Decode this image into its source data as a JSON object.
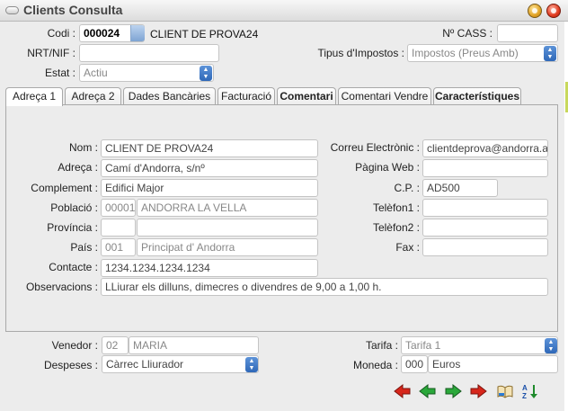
{
  "window": {
    "title": "Clients Consulta"
  },
  "header": {
    "codi_label": "Codi :",
    "codi_value": "000024",
    "client_name": "CLIENT DE PROVA24",
    "cass_label": "Nº CASS :",
    "cass_value": "",
    "nrt_label": "NRT/NIF :",
    "nrt_value": "",
    "tipus_label": "Tipus d'Impostos :",
    "tipus_value": "Impostos (Preus Amb)",
    "estat_label": "Estat :",
    "estat_value": "Actiu"
  },
  "tabs": [
    {
      "label": "Adreça 1"
    },
    {
      "label": "Adreça 2"
    },
    {
      "label": "Dades Bancàries"
    },
    {
      "label": "Facturació"
    },
    {
      "label": "Comentari"
    },
    {
      "label": "Comentari Vendre"
    },
    {
      "label": "Característiques"
    }
  ],
  "address": {
    "nom_label": "Nom :",
    "nom_value": "CLIENT DE PROVA24",
    "adreca_label": "Adreça :",
    "adreca_value": "Camí d'Andorra, s/nº",
    "complement_label": "Complement :",
    "complement_value": "Edifici Major",
    "poblacio_label": "Població :",
    "poblacio_code": "00001",
    "poblacio_name": "ANDORRA LA VELLA",
    "provincia_label": "Província :",
    "provincia_code": "",
    "provincia_name": "",
    "pais_label": "País :",
    "pais_code": "001",
    "pais_name": "Principat d' Andorra",
    "contacte_label": "Contacte :",
    "contacte_value": "1234.1234.1234.1234",
    "observacions_label": "Observacions :",
    "observacions_value": "LLiurar els dilluns, dimecres o divendres de 9,00 a 1,00 h.",
    "correu_label": "Correu Electrònic :",
    "correu_value": "clientdeprova@andorra.ad",
    "pagina_label": "Pàgina Web :",
    "pagina_value": "",
    "cp_label": "C.P. :",
    "cp_value": "AD500",
    "telefon1_label": "Telèfon1 :",
    "telefon1_value": "",
    "telefon2_label": "Telèfon2 :",
    "telefon2_value": "",
    "fax_label": "Fax :",
    "fax_value": ""
  },
  "footer": {
    "venedor_label": "Venedor :",
    "venedor_code": "02",
    "venedor_name": "MARIA",
    "despeses_label": "Despeses :",
    "despeses_value": "Càrrec Lliurador",
    "tarifa_label": "Tarifa :",
    "tarifa_value": "Tarifa 1",
    "moneda_label": "Moneda :",
    "moneda_code": "000",
    "moneda_name": "Euros"
  },
  "toolbar": [
    {
      "icon": "first-record-icon"
    },
    {
      "icon": "previous-record-icon"
    },
    {
      "icon": "next-record-icon"
    },
    {
      "icon": "last-record-icon"
    },
    {
      "icon": "book-icon"
    },
    {
      "icon": "sort-az-icon"
    }
  ]
}
